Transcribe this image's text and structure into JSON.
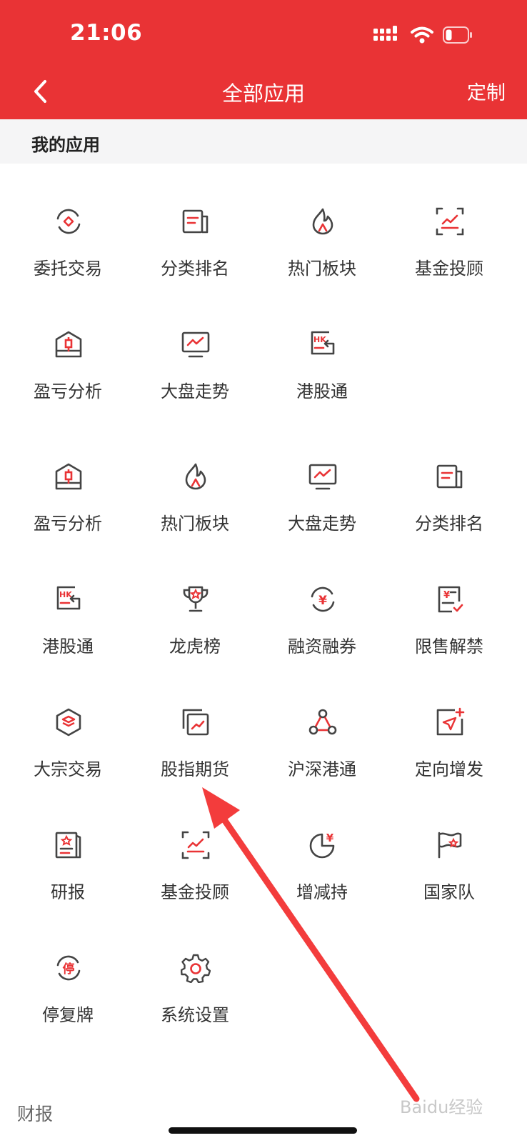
{
  "status_bar": {
    "time": "21:06"
  },
  "header": {
    "title": "全部应用",
    "custom_label": "定制"
  },
  "section": {
    "title": "我的应用"
  },
  "apps": [
    {
      "label": "委托交易",
      "icon": "exchange-diamond-icon"
    },
    {
      "label": "分类排名",
      "icon": "list-book-icon"
    },
    {
      "label": "热门板块",
      "icon": "flame-icon"
    },
    {
      "label": "基金投顾",
      "icon": "chart-frame-icon"
    },
    {
      "label": "盈亏分析",
      "icon": "box-candlestick-icon"
    },
    {
      "label": "大盘走势",
      "icon": "monitor-trend-icon"
    },
    {
      "label": "港股通",
      "icon": "hk-connect-icon"
    },
    {
      "label": "盈亏分析",
      "icon": "box-candlestick-icon"
    },
    {
      "label": "热门板块",
      "icon": "flame-icon"
    },
    {
      "label": "大盘走势",
      "icon": "monitor-trend-icon"
    },
    {
      "label": "分类排名",
      "icon": "list-book-icon"
    },
    {
      "label": "港股通",
      "icon": "hk-connect-icon"
    },
    {
      "label": "龙虎榜",
      "icon": "trophy-icon"
    },
    {
      "label": "融资融券",
      "icon": "yen-cycle-icon"
    },
    {
      "label": "限售解禁",
      "icon": "yen-document-check-icon"
    },
    {
      "label": "大宗交易",
      "icon": "hexagon-layers-icon"
    },
    {
      "label": "股指期货",
      "icon": "stacked-chart-icon"
    },
    {
      "label": "沪深港通",
      "icon": "triangle-nodes-icon"
    },
    {
      "label": "定向增发",
      "icon": "send-plus-icon"
    },
    {
      "label": "研报",
      "icon": "star-report-icon"
    },
    {
      "label": "基金投顾",
      "icon": "chart-frame-icon"
    },
    {
      "label": "增减持",
      "icon": "pie-yen-icon"
    },
    {
      "label": "国家队",
      "icon": "star-flag-icon"
    },
    {
      "label": "停复牌",
      "icon": "suspend-cycle-icon"
    },
    {
      "label": "系统设置",
      "icon": "gear-icon"
    }
  ],
  "footer": {
    "label": "财报"
  },
  "watermark": "Baidu经验",
  "colors": {
    "brand": "#e93335",
    "icon_stroke": "#444444",
    "icon_accent": "#e93335"
  }
}
